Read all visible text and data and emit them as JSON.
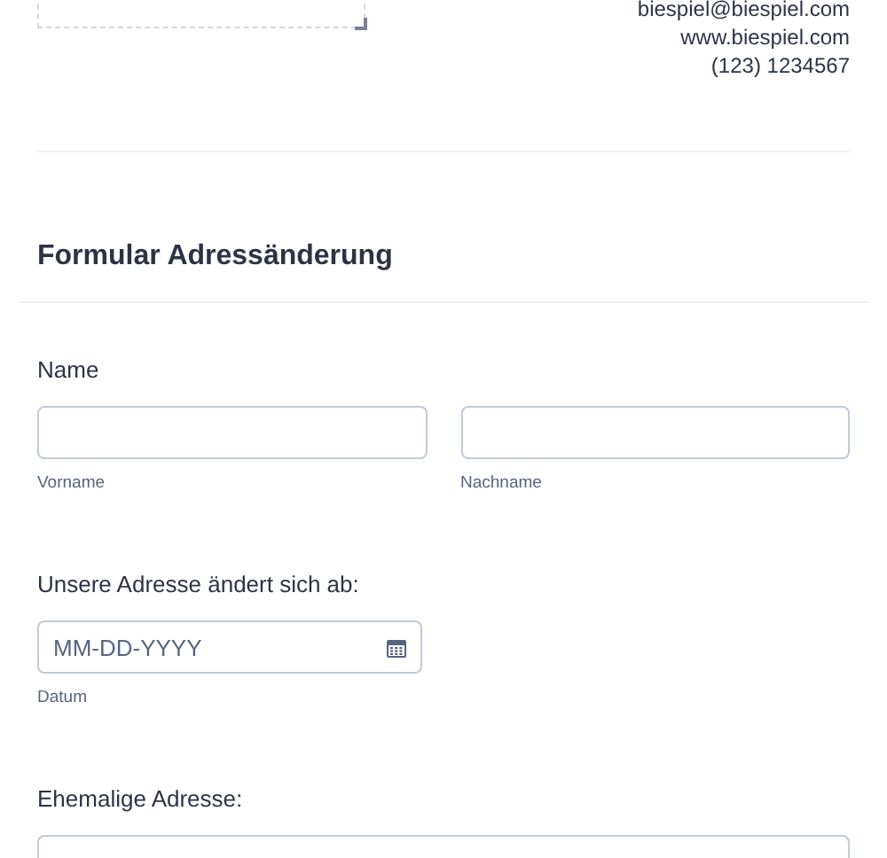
{
  "header": {
    "contact": [
      "biespiel@biespiel.com",
      "www.biespiel.com",
      "(123) 1234567"
    ]
  },
  "form_title": "Formular Adressänderung",
  "fields": [
    {
      "kind": "name",
      "label": "Name",
      "sublabels": [
        "Vorname",
        "Nachname"
      ]
    },
    {
      "kind": "date",
      "label": "Unsere Adresse ändert sich ab:",
      "placeholder": "MM-DD-YYYY",
      "sublabel": "Datum"
    },
    {
      "kind": "text",
      "label": "Ehemalige Adresse:"
    }
  ]
}
